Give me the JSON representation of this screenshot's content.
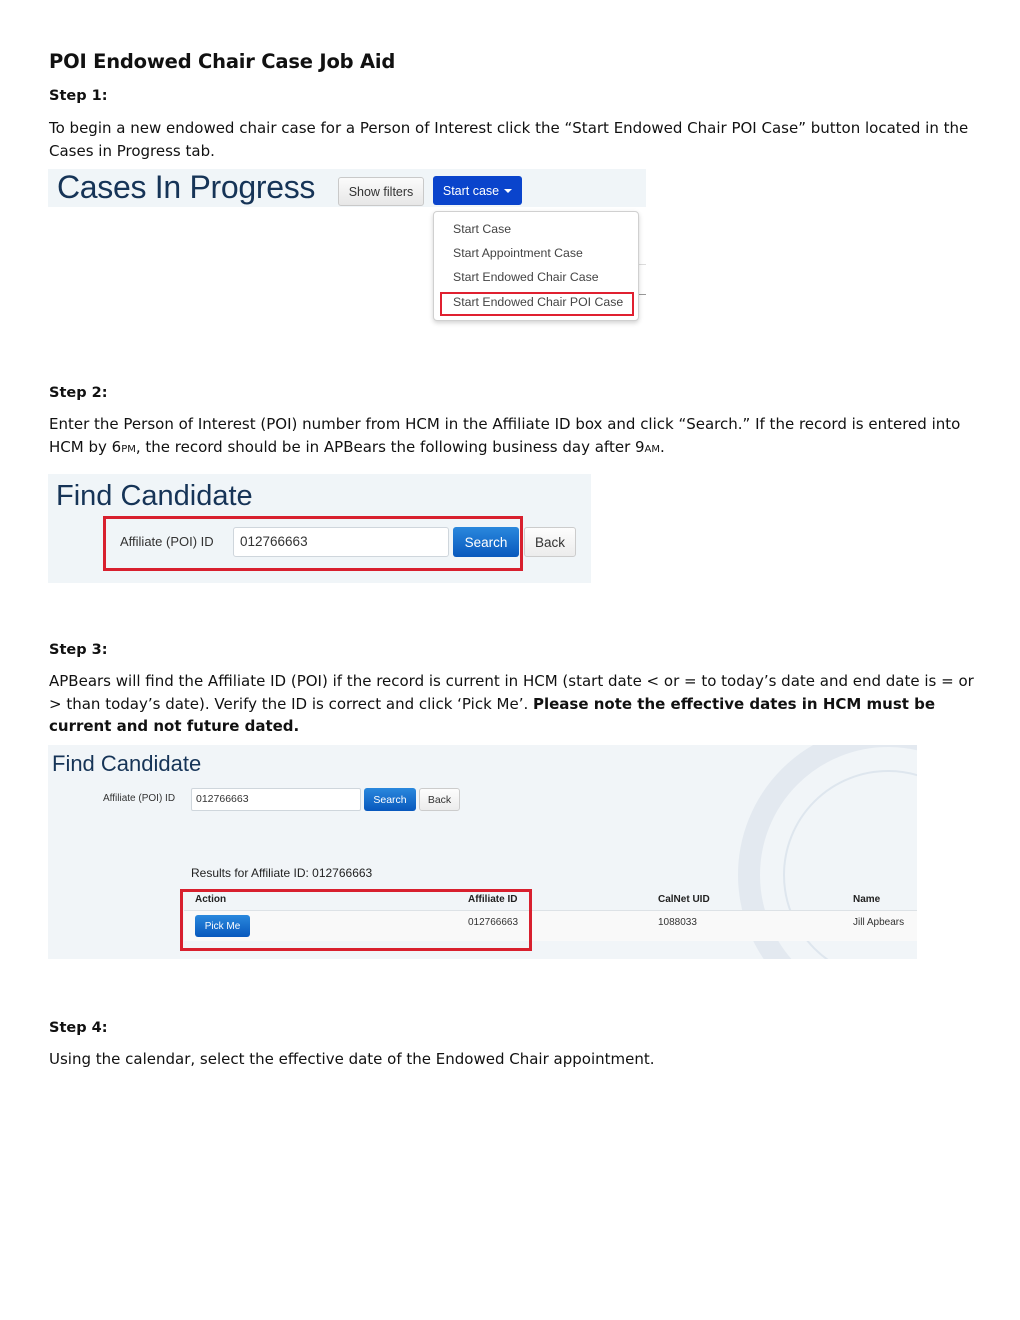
{
  "document": {
    "title": "POI Endowed Chair Case Job Aid",
    "steps": [
      {
        "heading": "Step 1:",
        "text": "To begin a new endowed chair case for a Person of Interest click the “Start Endowed Chair POI Case” button located in the Cases in Progress tab."
      },
      {
        "heading": "Step 2:",
        "text_a": "Enter the Person of Interest (POI) number from HCM in the Affiliate ID box and click “Search.” If the record is entered into HCM by 6",
        "pm": "PM",
        "text_b": ", the record should be in APBears the following business day after 9",
        "am": "AM",
        "text_c": "."
      },
      {
        "heading": "Step 3:",
        "text": "APBears will find the Affiliate ID (POI) if the record is current in HCM (start date < or = to today’s date and end date is = or > than today’s date). Verify the ID is correct and click ‘Pick Me’. ",
        "bold_text": "Please note the effective dates in HCM must be current and not future dated."
      },
      {
        "heading": "Step 4:",
        "text": "Using the calendar, select the effective date of the Endowed Chair appointment."
      }
    ]
  },
  "screenshot1": {
    "page_title": "Cases In Progress",
    "show_filters_label": "Show filters",
    "start_case_label": "Start case",
    "dropdown_items": [
      "Start Case",
      "Start Appointment Case",
      "Start Endowed Chair Case",
      "Start Endowed Chair POI Case"
    ],
    "highlighted_item": "Start Endowed Chair POI Case"
  },
  "screenshot2": {
    "page_title": "Find Candidate",
    "field_label": "Affiliate (POI) ID",
    "field_value": "012766663",
    "search_label": "Search",
    "back_label": "Back"
  },
  "screenshot3": {
    "page_title": "Find Candidate",
    "field_label": "Affiliate (POI) ID",
    "field_value": "012766663",
    "search_label": "Search",
    "back_label": "Back",
    "results_title": "Results for Affiliate ID: 012766663",
    "table": {
      "headers": [
        "Action",
        "Affiliate ID",
        "CalNet UID",
        "Name"
      ],
      "rows": [
        {
          "action": "Pick Me",
          "affiliate_id": "012766663",
          "calnet_uid": "1088033",
          "name": "Jill Apbears"
        }
      ]
    }
  },
  "colors": {
    "highlight_red": "#d8202e",
    "primary_blue": "#0a44cc",
    "title_navy": "#163457"
  }
}
